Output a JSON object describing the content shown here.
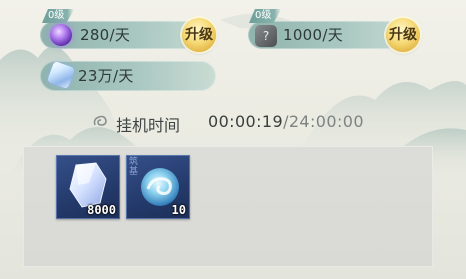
{
  "stats": [
    {
      "level": "0级",
      "icon": "purple-orb-icon",
      "value": "280/天",
      "button": "升级"
    },
    {
      "level": "0级",
      "icon": "stone-question-icon",
      "value": "1000/天",
      "button": "升级"
    },
    {
      "icon": "crystal-icon",
      "value": "23万/天"
    }
  ],
  "idle": {
    "label": "挂机时间",
    "elapsed": "00:00:19",
    "max": "/24:00:00"
  },
  "rewards": [
    {
      "icon": "spirit-crystal-icon",
      "count": "8000"
    },
    {
      "icon": "azure-orb-icon",
      "count": "10",
      "corner": "筑基"
    }
  ],
  "colors": {
    "pill": "#a9c8c1",
    "level_tag": "#6f9f9a",
    "upgrade": "#f6da76",
    "slot": "#2b4478"
  }
}
